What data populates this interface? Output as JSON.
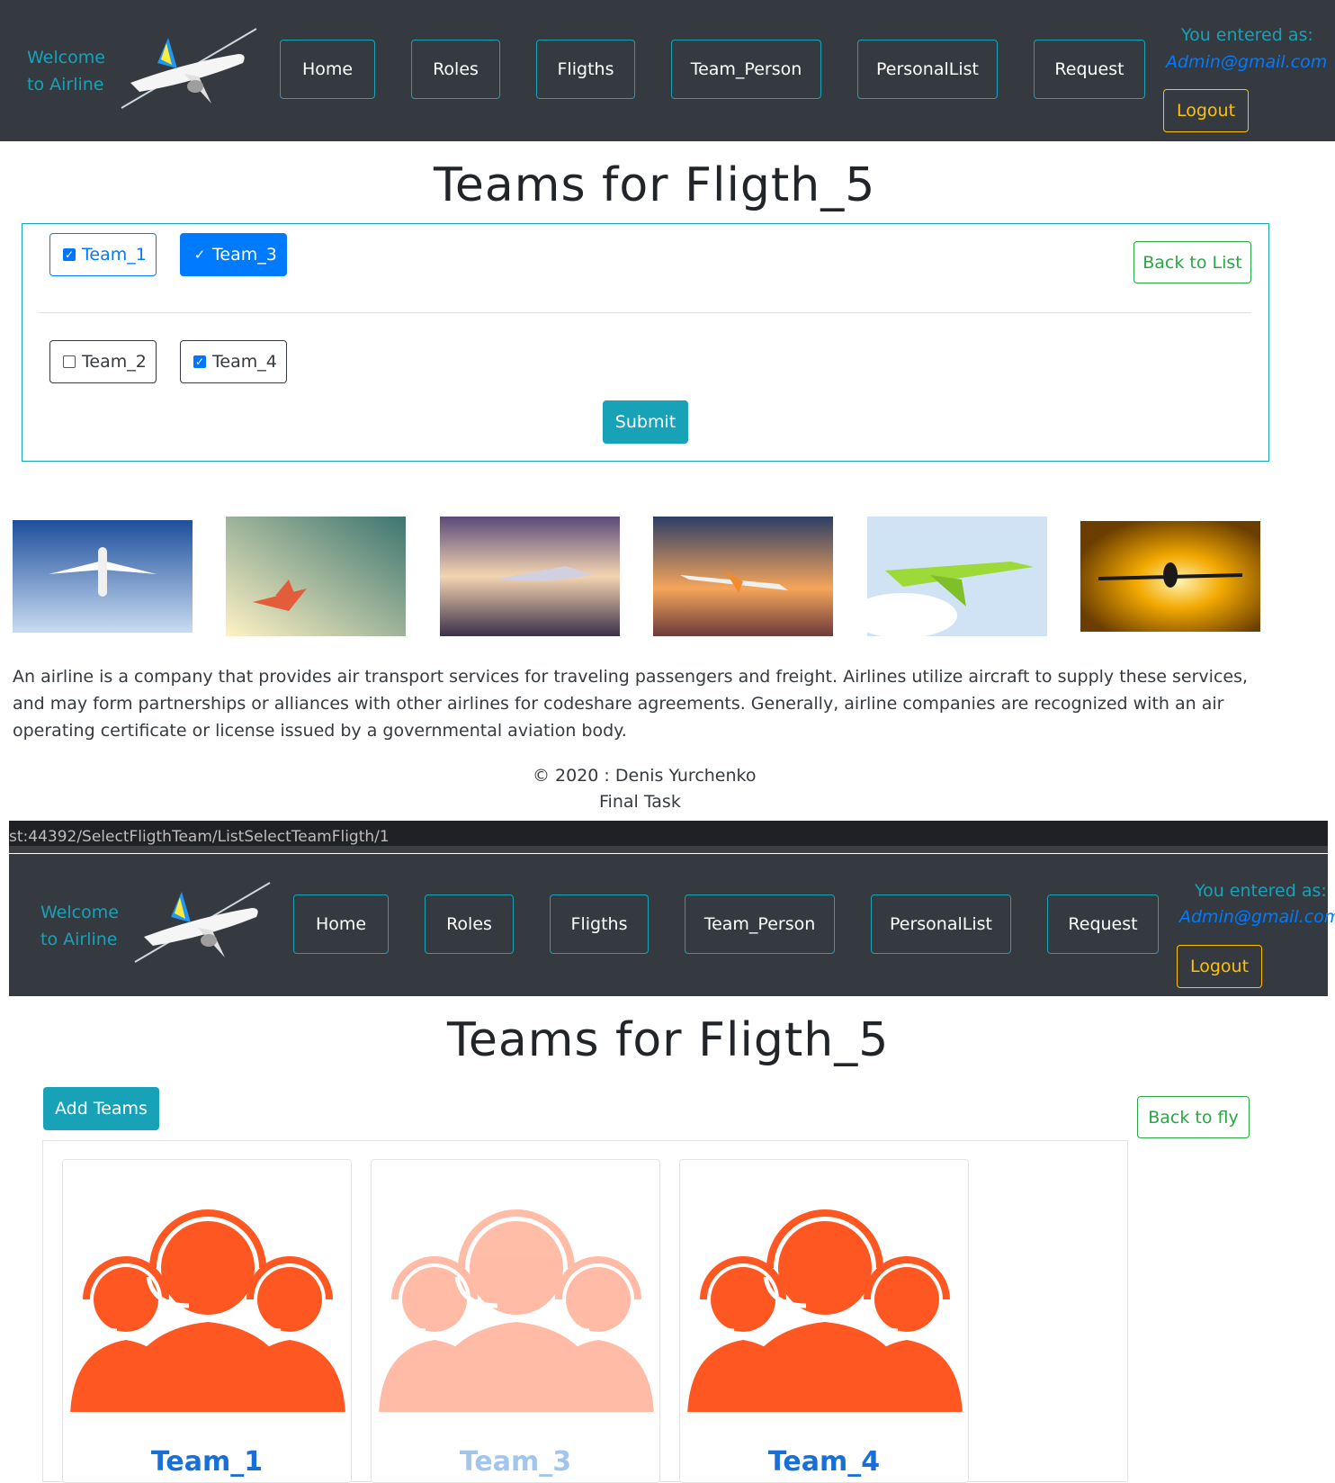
{
  "nav": {
    "brand_line1": "Welcome",
    "brand_line2": "to Airline",
    "items": [
      "Home",
      "Roles",
      "Fligths",
      "Team_Person",
      "PersonalList",
      "Request"
    ],
    "user_label": "You entered as:",
    "user_email": "Admin@gmail.com",
    "logout": "Logout"
  },
  "select_page": {
    "title": "Teams for Fligth_5",
    "teams": [
      {
        "label": "Team_1",
        "checked": true
      },
      {
        "label": "Team_3",
        "checked": true
      },
      {
        "label": "Team_2",
        "checked": false
      },
      {
        "label": "Team_4",
        "checked": true
      }
    ],
    "back_button": "Back to List",
    "submit_button": "Submit",
    "description": "An airline is a company that provides air transport services for traveling passengers and freight. Airlines utilize aircraft to supply these services, and may form partnerships or alliances with other airlines for codeshare agreements. Generally, airline companies are recognized with an air operating certificate or license issued by a governmental aviation body.",
    "footer_copyright": "© 2020 : Denis Yurchenko",
    "footer_task": "Final Task"
  },
  "url_bar": {
    "text": "st:44392/SelectFligthTeam/ListSelectTeamFligth/1"
  },
  "list_page": {
    "title": "Teams for Fligth_5",
    "add_button": "Add Teams",
    "back_button": "Back to fly",
    "cards": [
      {
        "name": "Team_1",
        "faded": false
      },
      {
        "name": "Team_3",
        "faded": true
      },
      {
        "name": "Team_4",
        "faded": false
      }
    ]
  },
  "colors": {
    "navbar_bg": "#343a40",
    "info": "#17a2b8",
    "primary": "#007bff",
    "success": "#28a745",
    "warning": "#ffc107",
    "team_icon": "#ff5722"
  },
  "icons": [
    "airplane-logo-icon",
    "team-headset-icon",
    "checkbox-checked-icon",
    "checkbox-unchecked-icon"
  ]
}
